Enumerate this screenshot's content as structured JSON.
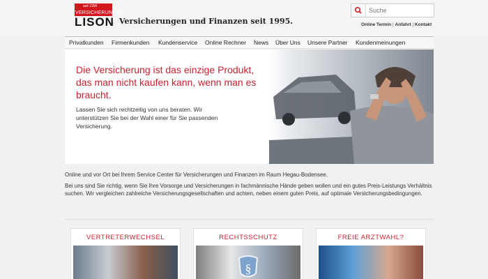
{
  "header": {
    "logo_tagline": "seit 1995",
    "logo_top": "VERSICHERUNGEN",
    "logo_name": "LISON",
    "tagline": "Versicherungen und Finanzen seit 1995.",
    "search_placeholder": "Suche",
    "links": [
      "Online Termin",
      "Anfahrt",
      "Kontakt"
    ]
  },
  "nav": [
    "Privatkunden",
    "Firmenkunden",
    "Kundenservice",
    "Online Rechner",
    "News",
    "Über Uns",
    "Unsere Partner",
    "Kundenmeinungen"
  ],
  "hero": {
    "headline": "Die Versicherung ist das einzige Produkt, das man nicht kaufen kann, wenn man es braucht.",
    "body": "Lassen Sie sich rechtzeitig von uns beraten. Wir unterstützen Sie bei der Wahl einer für Sie passenden Versicherung."
  },
  "intro": [
    "Online und vor Ort bei Ihrem Service Center für Versicherungen und Finanzen im Raum Hegau-Bodensee.",
    "Bei uns sind Sie richtig, wenn Sie Ihre Vorsorge und Versicherungen in fachmännische Hände geben wollen und ein gutes Preis-Leistungs Verhältnis suchen. Wir vergleichen zahlreiche Versicherungsgesellschaften und achten, neben einem guten Preis, auf optimale Versicherungsbedingungen."
  ],
  "cards": [
    "VERTRETERWECHSEL",
    "RECHTSSCHUTZ",
    "FREIE ARZTWAHL?"
  ],
  "colors": {
    "accent": "#d1161c",
    "headline": "#cc1f2e"
  }
}
